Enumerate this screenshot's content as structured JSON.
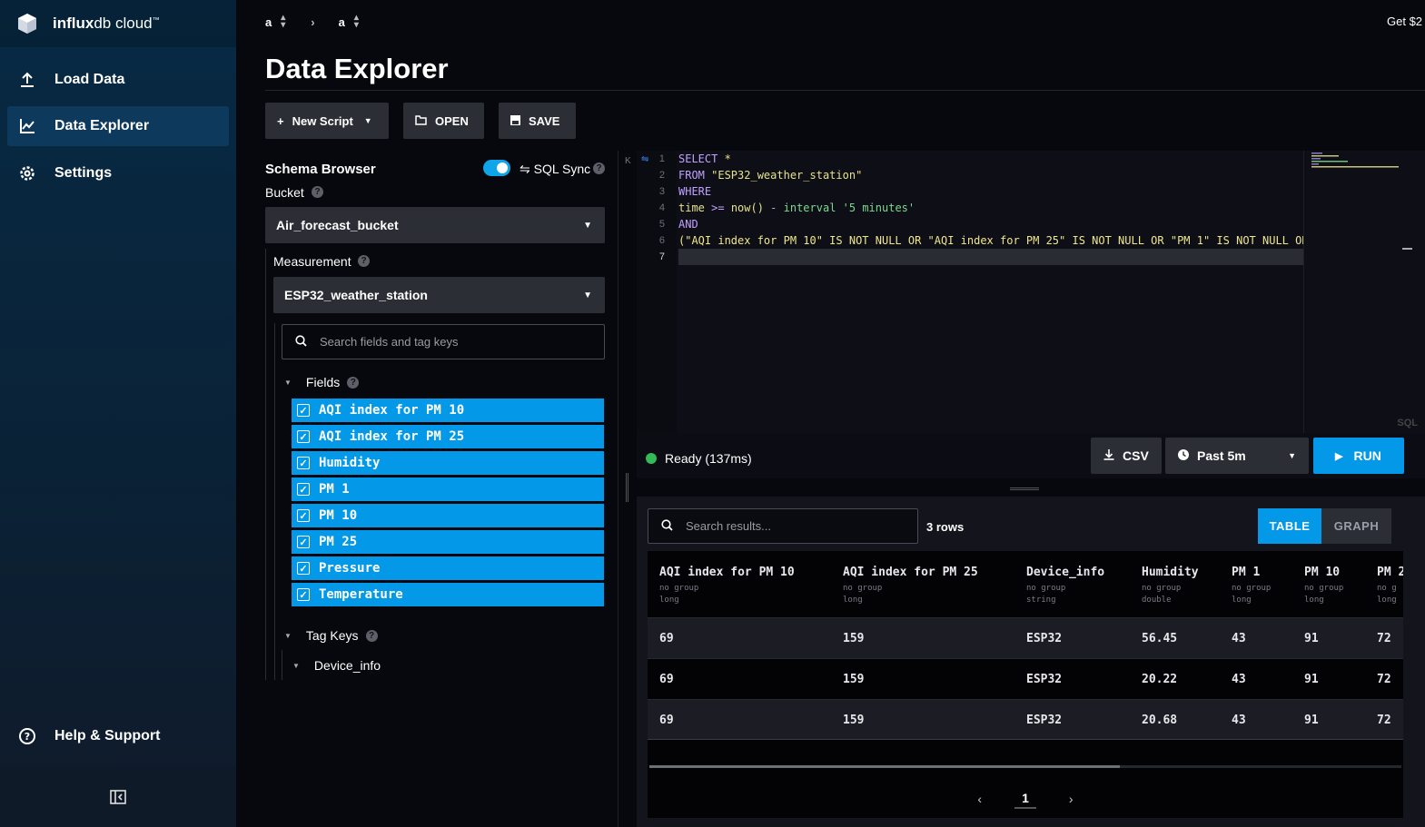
{
  "brand": {
    "name_bold": "influx",
    "name_rest": "db cloud",
    "tm": "™",
    "logo_icon": "influxdb-cube-icon"
  },
  "nav": {
    "items": [
      {
        "label": "Load Data",
        "icon": "upload-icon"
      },
      {
        "label": "Data Explorer",
        "icon": "graph-icon",
        "active": true
      },
      {
        "label": "Settings",
        "icon": "gear-icon"
      }
    ],
    "help": {
      "label": "Help & Support",
      "icon": "question-circle-icon"
    },
    "collapse_icon": "collapse-sidebar-icon"
  },
  "topbar": {
    "org": "a",
    "bucket": "a",
    "promo": "Get $2"
  },
  "page": {
    "title": "Data Explorer"
  },
  "toolbar": {
    "new_script": "New Script",
    "open": "OPEN",
    "save": "SAVE"
  },
  "schema": {
    "title": "Schema Browser",
    "sql_sync": "SQL Sync",
    "bucket_label": "Bucket",
    "bucket_value": "Air_forecast_bucket",
    "measurement_label": "Measurement",
    "measurement_value": "ESP32_weather_station",
    "search_placeholder": "Search fields and tag keys",
    "fields_label": "Fields",
    "fields": [
      "AQI index for PM 10",
      "AQI index for PM 25",
      "Humidity",
      "PM 1",
      "PM 10",
      "PM 25",
      "Pressure",
      "Temperature"
    ],
    "tag_keys_label": "Tag Keys",
    "tag_keys": [
      "Device_info"
    ]
  },
  "editor": {
    "line_numbers": [
      "1",
      "2",
      "3",
      "4",
      "5",
      "6",
      "7"
    ],
    "lines": {
      "l1a": "SELECT",
      "l1b": " *",
      "l2a": "FROM ",
      "l2b": "\"ESP32_weather_station\"",
      "l3": "WHERE",
      "l4a": "time",
      "l4b": " >= ",
      "l4c": "now()",
      "l4d": " - ",
      "l4e": "interval",
      "l4f": " '5 minutes'",
      "l5": "AND",
      "l6": "(\"AQI index for PM 10\" IS NOT NULL OR \"AQI index for PM 25\" IS NOT NULL OR \"PM 1\" IS NOT NULL OR"
    },
    "language_tag": "SQL"
  },
  "status": {
    "text": "Ready (137ms)",
    "csv": "CSV",
    "time_range": "Past 5m",
    "run": "RUN",
    "colors": {
      "ok": "#34bb55",
      "run": "#0498e8"
    }
  },
  "results": {
    "search_placeholder": "Search results...",
    "row_count": "3 rows",
    "view_table": "TABLE",
    "view_graph": "GRAPH",
    "columns": [
      {
        "name": "AQI index for PM 10",
        "group": "no group",
        "type": "long"
      },
      {
        "name": "AQI index for PM 25",
        "group": "no group",
        "type": "long"
      },
      {
        "name": "Device_info",
        "group": "no group",
        "type": "string"
      },
      {
        "name": "Humidity",
        "group": "no group",
        "type": "double"
      },
      {
        "name": "PM 1",
        "group": "no group",
        "type": "long"
      },
      {
        "name": "PM 10",
        "group": "no group",
        "type": "long"
      },
      {
        "name": "PM 2",
        "group": "no g",
        "type": "long"
      }
    ],
    "rows": [
      [
        "69",
        "159",
        "ESP32",
        "56.45",
        "43",
        "91",
        "72"
      ],
      [
        "69",
        "159",
        "ESP32",
        "20.22",
        "43",
        "91",
        "72"
      ],
      [
        "69",
        "159",
        "ESP32",
        "20.68",
        "43",
        "91",
        "72"
      ]
    ],
    "page": "1"
  }
}
